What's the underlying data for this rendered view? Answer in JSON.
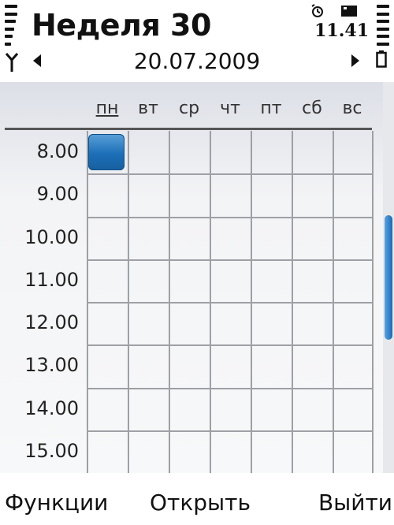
{
  "header": {
    "title": "Неделя 30",
    "time": "11.41",
    "date": "20.07.2009"
  },
  "week": {
    "days": [
      "пн",
      "вт",
      "ср",
      "чт",
      "пт",
      "сб",
      "вс"
    ],
    "active_day_index": 0,
    "hours": [
      "8.00",
      "9.00",
      "10.00",
      "11.00",
      "12.00",
      "13.00",
      "14.00",
      "15.00"
    ],
    "events": [
      {
        "day_index": 0,
        "hour_index": 0
      }
    ]
  },
  "scroll": {
    "position_fraction": 0.34,
    "visible_fraction": 0.32
  },
  "softkeys": {
    "left": "Функции",
    "center": "Открыть",
    "right": "Выйти"
  },
  "colors": {
    "event": "#1c6fb8",
    "scroll_thumb": "#2a7cc4",
    "grid_line": "#9ea0a5"
  },
  "icons": [
    "signal-strength-icon",
    "antenna-icon",
    "alarm-icon",
    "memory-card-icon",
    "battery-icon",
    "battery-level-icon"
  ]
}
